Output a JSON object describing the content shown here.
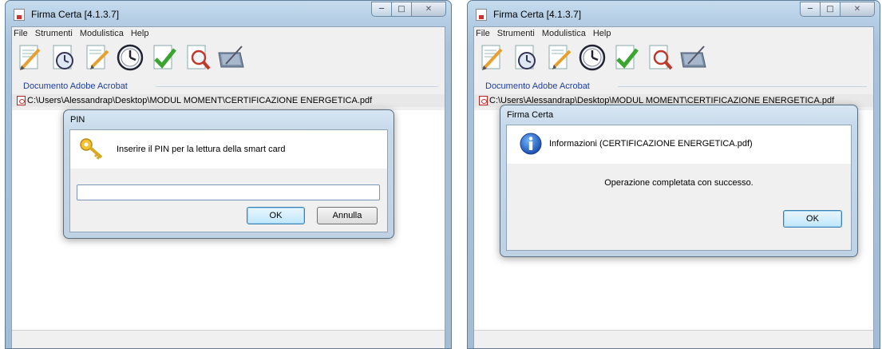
{
  "left_window": {
    "title": "Firma Certa [4.1.3.7]",
    "menu": [
      "File",
      "Strumenti",
      "Modulistica",
      "Help"
    ],
    "section_title": "Documento Adobe Acrobat",
    "file_path": "C:\\Users\\Alessandrap\\Desktop\\MODUL MOMENT\\CERTIFICAZIONE ENERGETICA.pdf"
  },
  "pin_dialog": {
    "title": "PIN",
    "message": "Inserire il PIN per la lettura della smart card",
    "pin_value": "",
    "ok_label": "OK",
    "cancel_label": "Annulla"
  },
  "right_window": {
    "title": "Firma Certa [4.1.3.7]",
    "menu": [
      "File",
      "Strumenti",
      "Modulistica",
      "Help"
    ],
    "section_title": "Documento Adobe Acrobat",
    "file_path": "C:\\Users\\Alessandrap\\Desktop\\MODUL MOMENT\\CERTIFICAZIONE ENERGETICA.pdf"
  },
  "info_dialog": {
    "title": "Firma Certa",
    "header": "Informazioni (CERTIFICAZIONE ENERGETICA.pdf)",
    "message": "Operazione completata con successo.",
    "ok_label": "OK"
  },
  "toolbar_icons": [
    "sign-document-icon",
    "timestamp-document-icon",
    "sign-edit-icon",
    "timestamp-icon",
    "verify-check-icon",
    "view-search-icon",
    "signature-pad-icon"
  ],
  "colors": {
    "accent": "#1f3e9e",
    "title_bar": "#b4cde4"
  }
}
